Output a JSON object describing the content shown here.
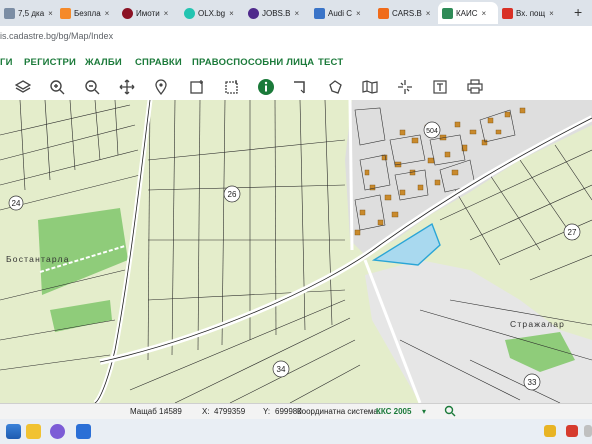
{
  "browser": {
    "tabs": [
      {
        "label": "7,5 дка",
        "color": "#7b8da4"
      },
      {
        "label": "Безпла",
        "color": "#f58a2a"
      },
      {
        "label": "Имоти",
        "color": "#8b1224"
      },
      {
        "label": "OLX.bg",
        "color": "#23c4b1"
      },
      {
        "label": "JOBS.B",
        "color": "#4f2a8c"
      },
      {
        "label": "Audi C",
        "color": "#3a74c8"
      },
      {
        "label": "CARS.B",
        "color": "#f06b1a"
      },
      {
        "label": "КАИС",
        "color": "#2e8b57"
      },
      {
        "label": "Вх. пощ",
        "color": "#d93025"
      }
    ],
    "tab_close_glyph": "×",
    "new_tab_glyph": "+",
    "url": "is.cadastre.bg/bg/Map/Index"
  },
  "menu": {
    "items": [
      "ГИ",
      "РЕГИСТРИ",
      "ЖАЛБИ",
      "СПРАВКИ",
      "ПРАВОСПОСОБНИ ЛИЦА",
      "ТЕСТ"
    ]
  },
  "toolbar": {
    "tools": [
      "layers-icon",
      "zoom-in-icon",
      "zoom-out-icon",
      "pan-icon",
      "location-pin-icon",
      "measure-area-icon",
      "measure-distance-icon",
      "info-icon",
      "corner-icon",
      "polygon-icon",
      "map-icon",
      "crosshair-icon",
      "text-icon",
      "print-icon"
    ],
    "active_tool": "info-icon"
  },
  "map": {
    "parcel_labels": [
      "24",
      "26",
      "27",
      "34",
      "33",
      "504"
    ],
    "place_labels": [
      "Бостантарла",
      "Стражалар"
    ],
    "colors": {
      "field": "#e4edcb",
      "urban": "#dedede",
      "forest": "#8fcc7a",
      "selected": "#a9d9ef"
    }
  },
  "status": {
    "scale_label": "Мащаб 1:",
    "scale_value": "4589",
    "x_label": "X:",
    "x_value": "4799359",
    "y_label": "Y:",
    "y_value": "699980",
    "crs_label": "Координатна система:",
    "crs_value": "ККС 2005",
    "crs_color": "#1b7a3a"
  }
}
